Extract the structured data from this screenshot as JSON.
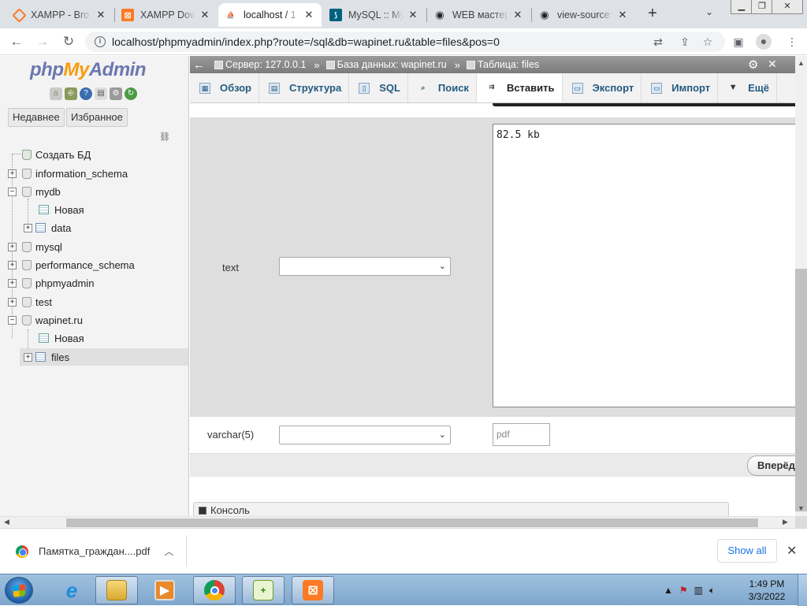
{
  "browser": {
    "tabs": [
      {
        "label": "XAMPP - Bro",
        "icon": "xampp-icon"
      },
      {
        "label": "XAMPP Dow",
        "icon": "xampp-icon"
      },
      {
        "label": "localhost / 1",
        "icon": "phpmyadmin-icon"
      },
      {
        "label": "MySQL :: My",
        "icon": "mysql-icon"
      },
      {
        "label": "WEB мастер",
        "icon": "eye-icon"
      },
      {
        "label": "view-source:",
        "icon": "eye-icon"
      }
    ],
    "active_tab_index": 2,
    "close_glyph": "✕",
    "new_tab_glyph": "+",
    "url": "localhost/phpmyadmin/index.php?route=/sql&db=wapinet.ru&table=files&pos=0"
  },
  "nav": {
    "logo_php": "php",
    "logo_my": "My",
    "logo_admin": "Admin",
    "tabs": [
      "Недавнее",
      "Избранное"
    ],
    "tree": [
      {
        "label": "Создать БД",
        "level": 0,
        "kind": "new",
        "expander": ""
      },
      {
        "label": "information_schema",
        "level": 0,
        "kind": "db",
        "expander": "+"
      },
      {
        "label": "mydb",
        "level": 0,
        "kind": "db",
        "expander": "−"
      },
      {
        "label": "Новая",
        "level": 1,
        "kind": "new",
        "expander": ""
      },
      {
        "label": "data",
        "level": 1,
        "kind": "table",
        "expander": "+"
      },
      {
        "label": "mysql",
        "level": 0,
        "kind": "db",
        "expander": "+"
      },
      {
        "label": "performance_schema",
        "level": 0,
        "kind": "db",
        "expander": "+"
      },
      {
        "label": "phpmyadmin",
        "level": 0,
        "kind": "db",
        "expander": "+"
      },
      {
        "label": "test",
        "level": 0,
        "kind": "db",
        "expander": "+"
      },
      {
        "label": "wapinet.ru",
        "level": 0,
        "kind": "db",
        "expander": "−"
      },
      {
        "label": "Новая",
        "level": 1,
        "kind": "new",
        "expander": ""
      },
      {
        "label": "files",
        "level": 1,
        "kind": "table",
        "expander": "+",
        "selected": true
      }
    ]
  },
  "main": {
    "breadcrumb": {
      "back": "←",
      "server": "Сервер: 127.0.0.1",
      "database": "База данных: wapinet.ru",
      "table": "Таблица: files",
      "separator": "»"
    },
    "menu": [
      {
        "label": "Обзор",
        "icon": "browse-icon"
      },
      {
        "label": "Структура",
        "icon": "structure-icon"
      },
      {
        "label": "SQL",
        "icon": "sql-icon"
      },
      {
        "label": "Поиск",
        "icon": "search-icon"
      },
      {
        "label": "Вставить",
        "icon": "insert-icon",
        "active": true
      },
      {
        "label": "Экспорт",
        "icon": "export-icon"
      },
      {
        "label": "Импорт",
        "icon": "import-icon"
      },
      {
        "label": "Ещё",
        "icon": "chevron-down-icon"
      }
    ],
    "fields": [
      {
        "type": "text",
        "function_value": "",
        "value": "82.5 kb"
      },
      {
        "type": "varchar(5)",
        "function_value": "",
        "value": "pdf"
      }
    ],
    "go_button": "Вперёд",
    "console_label": "Консоль"
  },
  "downloads": {
    "filename": "Памятка_граждан....pdf",
    "show_all": "Show all",
    "close_glyph": "✕"
  },
  "taskbar": {
    "time": "1:49 PM",
    "date": "3/3/2022"
  },
  "colors": {
    "pma_blue": "#235a81",
    "pma_orange": "#f89c0e",
    "form_gray": "#dedede",
    "link_blue": "#1a73e8"
  }
}
